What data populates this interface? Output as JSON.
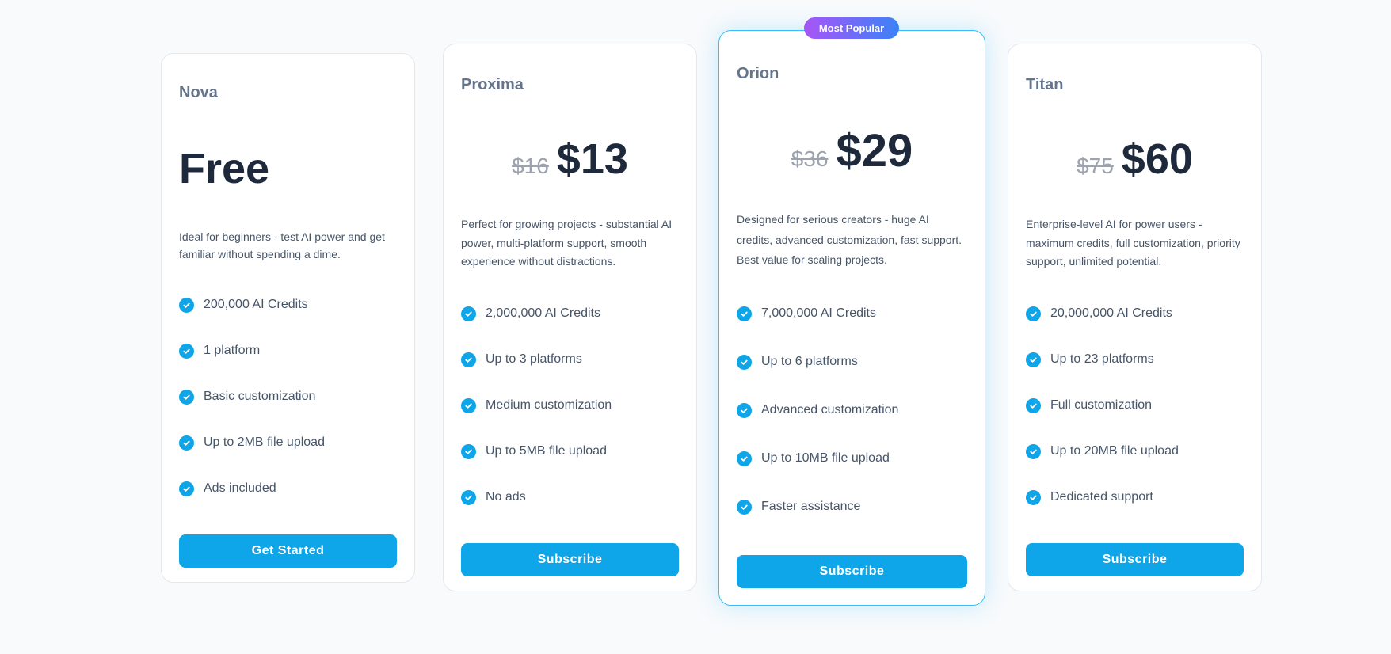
{
  "badge": "Most Popular",
  "colors": {
    "accent": "#0ea5e9",
    "badge_from": "#a855f7",
    "badge_to": "#3b82f6",
    "title": "#1e293b"
  },
  "plans": [
    {
      "name": "Nova",
      "price": "Free",
      "old_price": null,
      "description": "Ideal for beginners - test AI power and get familiar without spending a dime.",
      "features": [
        "200,000 AI Credits",
        "1 platform",
        "Basic customization",
        "Up to 2MB file upload",
        "Ads included"
      ],
      "button": "Get Started"
    },
    {
      "name": "Proxima",
      "price": "$13",
      "old_price": "$16",
      "description": "Perfect for growing projects - substantial AI power, multi-platform support, smooth experience without distractions.",
      "features": [
        "2,000,000 AI Credits",
        "Up to 3 platforms",
        "Medium customization",
        "Up to 5MB file upload",
        "No ads"
      ],
      "button": "Subscribe"
    },
    {
      "name": "Orion",
      "price": "$29",
      "old_price": "$36",
      "description": "Designed for serious creators - huge AI credits, advanced customization, fast support. Best value for scaling projects.",
      "features": [
        "7,000,000 AI Credits",
        "Up to 6 platforms",
        "Advanced customization",
        "Up to 10MB file upload",
        "Faster assistance"
      ],
      "button": "Subscribe",
      "popular": true
    },
    {
      "name": "Titan",
      "price": "$60",
      "old_price": "$75",
      "description": "Enterprise-level AI for power users - maximum credits, full customization, priority support, unlimited potential.",
      "features": [
        "20,000,000 AI Credits",
        "Up to 23 platforms",
        "Full customization",
        "Up to 20MB file upload",
        "Dedicated support"
      ],
      "button": "Subscribe"
    }
  ]
}
